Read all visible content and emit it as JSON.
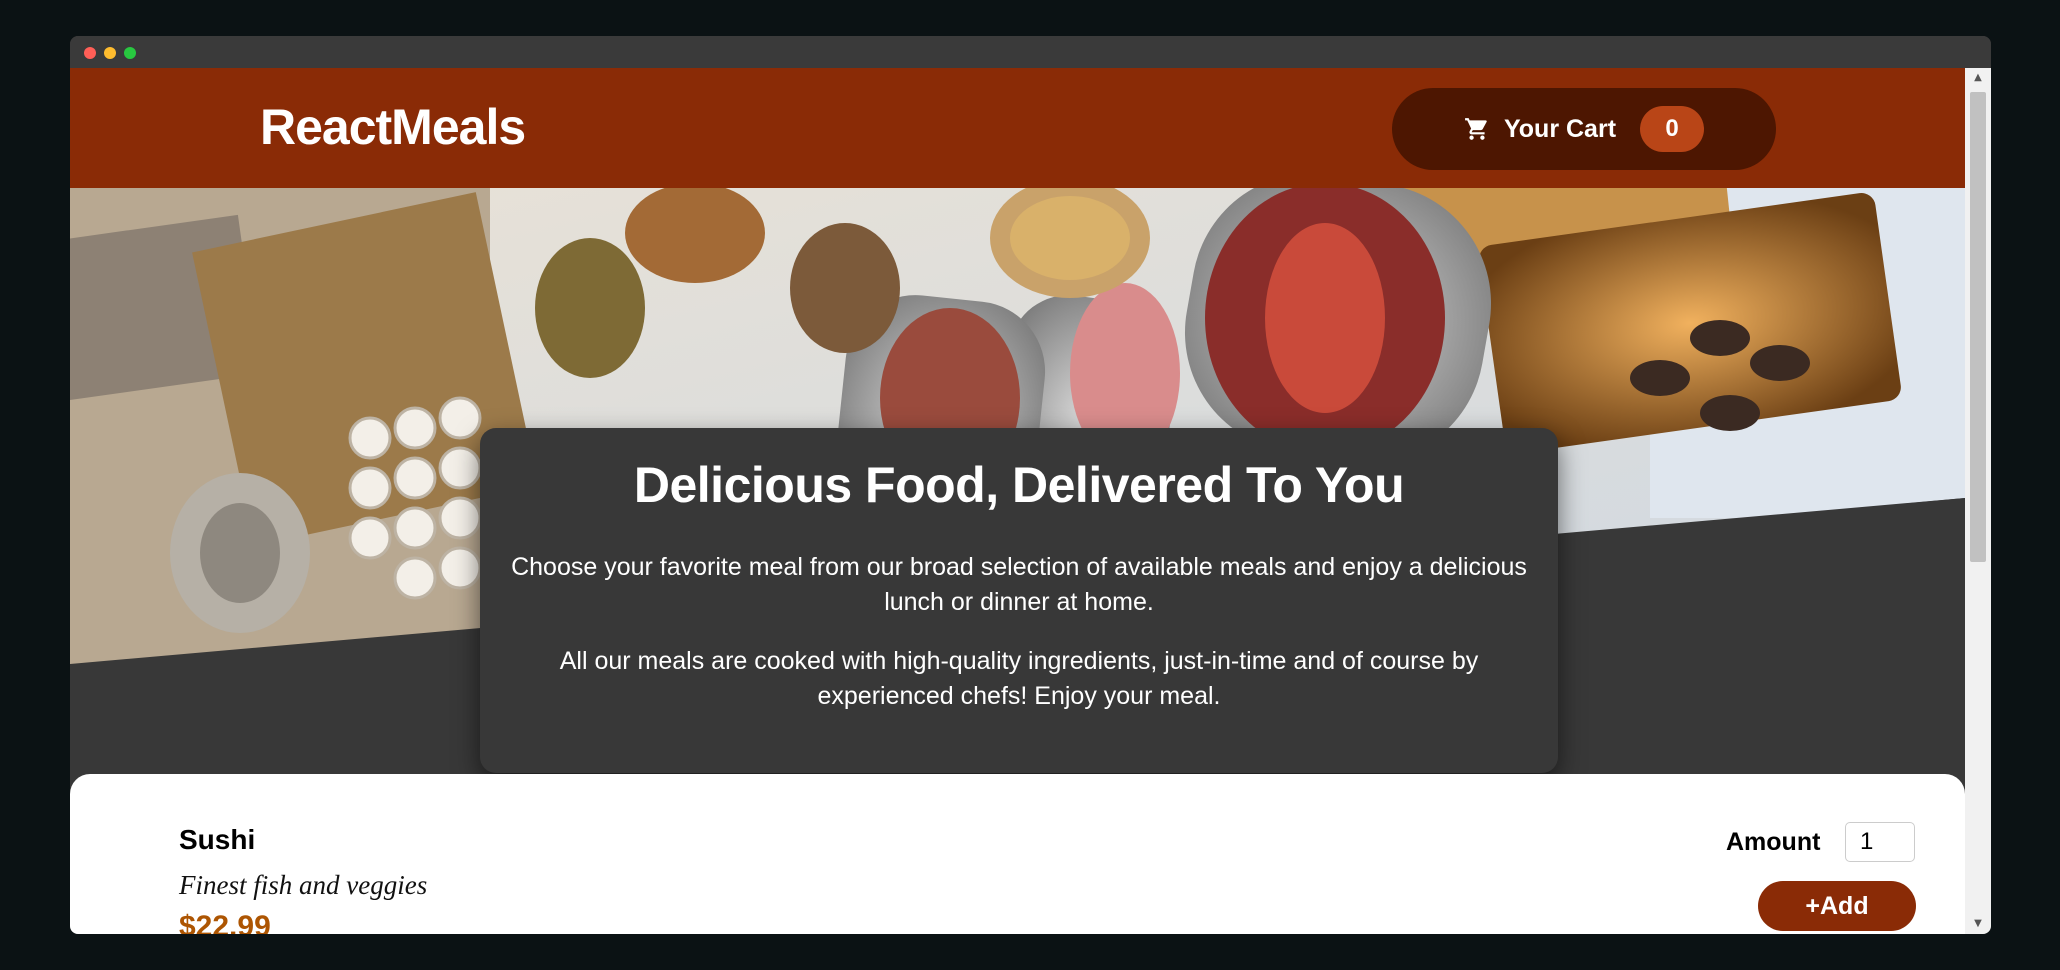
{
  "app": {
    "logo": "ReactMeals"
  },
  "cart": {
    "label": "Your Cart",
    "count": "0",
    "icon": "cart-icon"
  },
  "summary": {
    "title": "Delicious Food, Delivered To You",
    "paragraph1": "Choose your favorite meal from our broad selection of available meals and enjoy a delicious lunch or dinner at home.",
    "paragraph2": "All our meals are cooked with high-quality ingredients, just-in-time and of course by experienced chefs! Enjoy your meal."
  },
  "meals": [
    {
      "name": "Sushi",
      "description": "Finest fish and veggies",
      "price": "$22.99",
      "amount_label": "Amount",
      "amount_value": "1",
      "add_label": "+Add"
    }
  ],
  "colors": {
    "header": "#8a2b06",
    "cart_button": "#4d1601",
    "badge": "#b94517",
    "price": "#ad5502",
    "page_bg": "#383838"
  }
}
